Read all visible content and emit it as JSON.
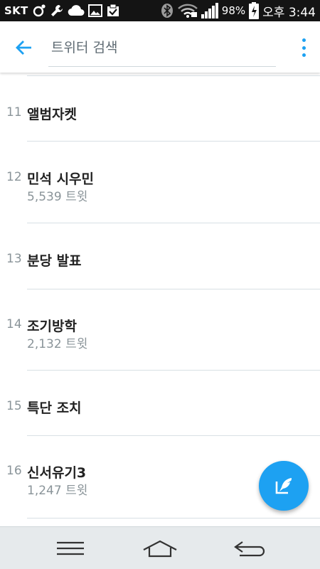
{
  "status_bar": {
    "carrier": "SKT",
    "battery_percent": "98%",
    "time": "오후 3:44",
    "icons": [
      "app-icon",
      "wrench-icon",
      "cloud-icon",
      "image-icon",
      "clipboard-check-icon",
      "bluetooth-icon",
      "wifi-icon",
      "signal-icon",
      "battery-charging-icon"
    ]
  },
  "app_bar": {
    "search_text": "트위터 검색",
    "accent_color": "#1da1f2"
  },
  "trends": [
    {
      "rank": "11",
      "title": "앨범자켓",
      "count": ""
    },
    {
      "rank": "12",
      "title": "민석 시우민",
      "count": "5,539 트윗"
    },
    {
      "rank": "13",
      "title": "분당 발표",
      "count": ""
    },
    {
      "rank": "14",
      "title": "조기방학",
      "count": "2,132 트윗"
    },
    {
      "rank": "15",
      "title": "특단 조치",
      "count": ""
    },
    {
      "rank": "16",
      "title": "신서유기3",
      "count": "1,247 트윗"
    }
  ],
  "nav_bar": {
    "icons": [
      "menu-icon",
      "home-icon",
      "back-icon"
    ]
  }
}
